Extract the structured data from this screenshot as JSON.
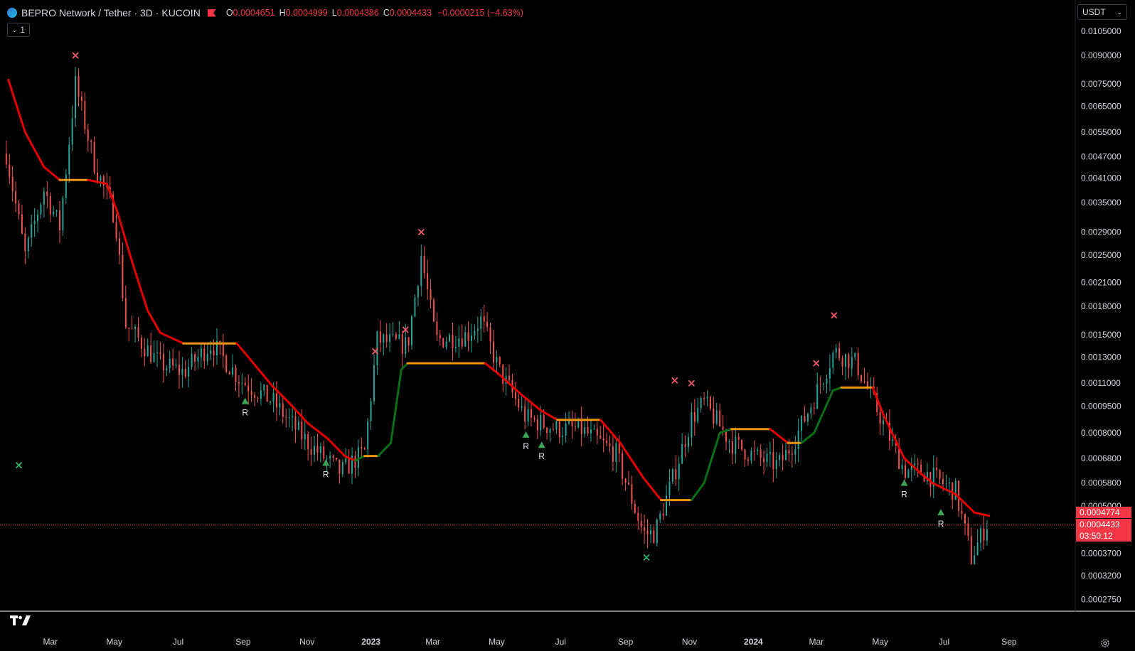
{
  "header": {
    "symbol": "BEPRO Network / Tether · 3D · KUCOIN",
    "open_label": "O",
    "open": "0.0004651",
    "high_label": "H",
    "high": "0.0004999",
    "low_label": "L",
    "low": "0.0004386",
    "close_label": "C",
    "close": "0.0004433",
    "change": "−0.0000215 (−4.63%)"
  },
  "indicator_toggle": {
    "count": "1"
  },
  "currency_button": {
    "label": "USDT"
  },
  "price_axis": [
    "0.0105000",
    "0.0090000",
    "0.0075000",
    "0.0065000",
    "0.0055000",
    "0.0047000",
    "0.0041000",
    "0.0035000",
    "0.0029000",
    "0.0025000",
    "0.0021000",
    "0.0018000",
    "0.0015000",
    "0.0013000",
    "0.0011000",
    "0.0009500",
    "0.0008000",
    "0.0006800",
    "0.0005800",
    "0.0005000",
    "0.0003700",
    "0.0003200",
    "0.0002750"
  ],
  "price_tags": {
    "indicator_value": "0.0004774",
    "last_price": "0.0004433",
    "countdown": "03:50:12"
  },
  "time_axis": [
    "Mar",
    "May",
    "Jul",
    "Sep",
    "Nov",
    "2023",
    "Mar",
    "May",
    "Jul",
    "Sep",
    "Nov",
    "2024",
    "Mar",
    "May",
    "Jul",
    "Sep"
  ],
  "markers": {
    "signal_label": "R"
  },
  "colors": {
    "up_candle": "#26a69a",
    "down_candle": "#ef5350",
    "trend_down": "#e50000",
    "trend_up": "#0b6e16",
    "trend_flat": "#f0950b",
    "cross_sell": "#f25a6a",
    "cross_buy": "#33b36a",
    "triangle": "#3fa556",
    "last_price_line": "#f23645"
  },
  "chart_data": {
    "type": "candlestick",
    "symbol": "BEPRO/USDT",
    "interval": "3D",
    "scale": "log",
    "x_range": [
      "2022-02",
      "2024-09"
    ],
    "ylim": [
      0.000255,
      0.0112
    ],
    "last": 0.0004433,
    "trend_line": [
      [
        "2022-01-22",
        0.0077
      ],
      [
        "2022-02-07",
        0.0055
      ],
      [
        "2022-02-25",
        0.0044
      ],
      [
        "2022-03-12",
        0.00405
      ],
      [
        "2022-04-08",
        0.00405
      ],
      [
        "2022-04-26",
        0.00395
      ],
      [
        "2022-05-06",
        0.0033
      ],
      [
        "2022-05-20",
        0.0024
      ],
      [
        "2022-06-04",
        0.00175
      ],
      [
        "2022-06-16",
        0.00152
      ],
      [
        "2022-07-08",
        0.00142
      ],
      [
        "2022-07-25",
        0.00142
      ],
      [
        "2022-08-10",
        0.00142
      ],
      [
        "2022-08-28",
        0.00142
      ],
      [
        "2022-09-10",
        0.00128
      ],
      [
        "2022-10-01",
        0.00108
      ],
      [
        "2022-10-17",
        0.00097
      ],
      [
        "2022-11-04",
        0.00085
      ],
      [
        "2022-11-23",
        0.00077
      ],
      [
        "2022-12-09",
        0.00069
      ],
      [
        "2022-12-19",
        0.00067
      ],
      [
        "2022-12-28",
        0.00069
      ],
      [
        "2023-01-10",
        0.00069
      ],
      [
        "2023-01-22",
        0.00075
      ],
      [
        "2023-02-01",
        0.0012
      ],
      [
        "2023-02-07",
        0.00125
      ],
      [
        "2023-02-27",
        0.00125
      ],
      [
        "2023-03-17",
        0.00125
      ],
      [
        "2023-03-31",
        0.00125
      ],
      [
        "2023-04-22",
        0.00125
      ],
      [
        "2023-05-03",
        0.00118
      ],
      [
        "2023-05-27",
        0.00102
      ],
      [
        "2023-06-15",
        0.00092
      ],
      [
        "2023-06-30",
        0.00087
      ],
      [
        "2023-07-22",
        0.00087
      ],
      [
        "2023-08-10",
        0.00087
      ],
      [
        "2023-08-29",
        0.00075
      ],
      [
        "2023-09-20",
        0.0006
      ],
      [
        "2023-10-07",
        0.00052
      ],
      [
        "2023-10-20",
        0.00052
      ],
      [
        "2023-11-05",
        0.00052
      ],
      [
        "2023-11-17",
        0.00058
      ],
      [
        "2023-12-02",
        0.0008
      ],
      [
        "2023-12-13",
        0.00082
      ],
      [
        "2023-12-30",
        0.00082
      ],
      [
        "2024-01-19",
        0.00082
      ],
      [
        "2024-02-05",
        0.00075
      ],
      [
        "2024-02-18",
        0.00075
      ],
      [
        "2024-03-01",
        0.0008
      ],
      [
        "2024-03-19",
        0.00105
      ],
      [
        "2024-03-27",
        0.00107
      ],
      [
        "2024-04-10",
        0.00107
      ],
      [
        "2024-04-26",
        0.00107
      ],
      [
        "2024-05-06",
        0.0009
      ],
      [
        "2024-05-26",
        0.00068
      ],
      [
        "2024-06-10",
        0.00062
      ],
      [
        "2024-06-22",
        0.00058
      ],
      [
        "2024-07-14",
        0.00054
      ],
      [
        "2024-08-01",
        0.00048
      ],
      [
        "2024-08-15",
        0.00047
      ]
    ],
    "sell_markers": [
      [
        "2022-03-27",
        0.009
      ],
      [
        "2023-01-07",
        0.00135
      ],
      [
        "2023-02-20",
        0.0029
      ],
      [
        "2023-02-05",
        0.00155
      ],
      [
        "2023-10-20",
        0.00112
      ],
      [
        "2023-11-05",
        0.0011
      ],
      [
        "2024-03-03",
        0.00125
      ],
      [
        "2024-03-20",
        0.0017
      ]
    ],
    "buy_markers": [
      [
        "2022-02-01",
        0.00065
      ],
      [
        "2023-09-23",
        0.00036
      ]
    ],
    "reversal_markers": [
      [
        "2022-09-05",
        0.00098
      ],
      [
        "2022-11-21",
        0.00066
      ],
      [
        "2023-05-31",
        0.00079
      ],
      [
        "2023-06-15",
        0.00074
      ],
      [
        "2024-05-26",
        0.00058
      ],
      [
        "2024-06-30",
        0.00048
      ]
    ],
    "candle_path": [
      [
        "2022-01-20",
        0.0048
      ],
      [
        "2022-02-07",
        0.0025
      ],
      [
        "2022-02-25",
        0.0038
      ],
      [
        "2022-03-12",
        0.003
      ],
      [
        "2022-03-27",
        0.0075
      ],
      [
        "2022-04-14",
        0.0045
      ],
      [
        "2022-05-04",
        0.0032
      ],
      [
        "2022-05-14",
        0.0016
      ],
      [
        "2022-06-15",
        0.00125
      ],
      [
        "2022-07-08",
        0.00118
      ],
      [
        "2022-08-04",
        0.00142
      ],
      [
        "2022-09-01",
        0.00112
      ],
      [
        "2022-10-01",
        0.00098
      ],
      [
        "2022-11-04",
        0.00075
      ],
      [
        "2022-12-05",
        0.00062
      ],
      [
        "2022-12-28",
        0.00071
      ],
      [
        "2023-01-09",
        0.00145
      ],
      [
        "2023-02-07",
        0.0014
      ],
      [
        "2023-02-20",
        0.0025
      ],
      [
        "2023-03-06",
        0.00145
      ],
      [
        "2023-04-05",
        0.0015
      ],
      [
        "2023-04-18",
        0.00165
      ],
      [
        "2023-05-05",
        0.0012
      ],
      [
        "2023-05-31",
        0.00088
      ],
      [
        "2023-06-30",
        0.00082
      ],
      [
        "2023-07-22",
        0.00082
      ],
      [
        "2023-08-25",
        0.0007
      ],
      [
        "2023-09-20",
        0.00042
      ],
      [
        "2023-10-01",
        0.00042
      ],
      [
        "2023-10-20",
        0.00062
      ],
      [
        "2023-11-05",
        0.00088
      ],
      [
        "2023-11-17",
        0.00097
      ],
      [
        "2023-12-13",
        0.00075
      ],
      [
        "2024-01-08",
        0.00068
      ],
      [
        "2024-01-27",
        0.00065
      ],
      [
        "2024-02-10",
        0.00075
      ],
      [
        "2024-03-01",
        0.001
      ],
      [
        "2024-03-20",
        0.00135
      ],
      [
        "2024-04-10",
        0.00125
      ],
      [
        "2024-05-06",
        0.00085
      ],
      [
        "2024-05-26",
        0.00063
      ],
      [
        "2024-06-15",
        0.00062
      ],
      [
        "2024-07-14",
        0.00055
      ],
      [
        "2024-07-29",
        0.00036
      ],
      [
        "2024-08-15",
        0.00046
      ]
    ]
  }
}
